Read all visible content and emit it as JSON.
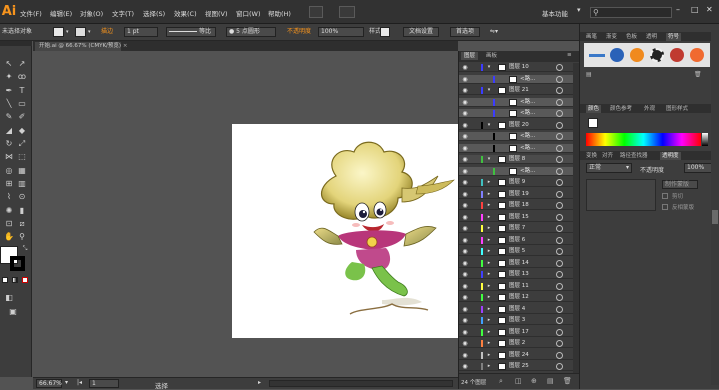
{
  "app": {
    "logo": "Ai"
  },
  "menu": [
    "文件(F)",
    "编辑(E)",
    "对象(O)",
    "文字(T)",
    "选择(S)",
    "效果(C)",
    "视图(V)",
    "窗口(W)",
    "帮助(H)"
  ],
  "workspace": "基本功能",
  "search_icon": "search-icon",
  "window_buttons": [
    "–",
    "□",
    "✕"
  ],
  "controlbar": {
    "selection": "未选择对象",
    "stroke_label": "描边",
    "stroke_value": "1 pt",
    "profile_label": "等比",
    "brush_value": "5 点圆形",
    "opacity_label": "不透明度",
    "opacity_value": "100%",
    "style_label": "样式",
    "doc_setup": "文档设置",
    "preferences": "首选项"
  },
  "document_tab": "开始.ai @ 66.67% (CMYK/预览)",
  "layers_panel": {
    "tabs": [
      "图层",
      "画板"
    ],
    "rows": [
      {
        "name": "图层 10",
        "color": "#3c3cff",
        "expanded": true,
        "sub": false
      },
      {
        "name": "<路...",
        "color": "#3c3cff",
        "expanded": false,
        "sub": true
      },
      {
        "name": "图层 21",
        "color": "#3c3cff",
        "expanded": true,
        "sub": false
      },
      {
        "name": "<路...",
        "color": "#3c3cff",
        "expanded": false,
        "sub": true
      },
      {
        "name": "<路...",
        "color": "#3c3cff",
        "expanded": false,
        "sub": true
      },
      {
        "name": "图层 20",
        "color": "#000000",
        "expanded": true,
        "sub": false
      },
      {
        "name": "<路...",
        "color": "#000000",
        "expanded": false,
        "sub": true
      },
      {
        "name": "<路...",
        "color": "#000000",
        "expanded": false,
        "sub": true
      },
      {
        "name": "图层 8",
        "color": "#40c040",
        "expanded": true,
        "sub": false
      },
      {
        "name": "<路...",
        "color": "#40c040",
        "expanded": false,
        "sub": true
      },
      {
        "name": "图层 9",
        "color": "#40c0c0",
        "expanded": false,
        "sub": false
      },
      {
        "name": "图层 19",
        "color": "#8080ff",
        "expanded": false,
        "sub": false
      },
      {
        "name": "图层 18",
        "color": "#ff4040",
        "expanded": false,
        "sub": false
      },
      {
        "name": "图层 15",
        "color": "#ff40ff",
        "expanded": false,
        "sub": false
      },
      {
        "name": "图层 7",
        "color": "#ffff40",
        "expanded": false,
        "sub": false
      },
      {
        "name": "图层 6",
        "color": "#ff40ff",
        "expanded": false,
        "sub": false
      },
      {
        "name": "图层 5",
        "color": "#40ffff",
        "expanded": false,
        "sub": false
      },
      {
        "name": "图层 14",
        "color": "#40ff40",
        "expanded": false,
        "sub": false
      },
      {
        "name": "图层 13",
        "color": "#4040ff",
        "expanded": false,
        "sub": false
      },
      {
        "name": "图层 11",
        "color": "#ffff40",
        "expanded": false,
        "sub": false
      },
      {
        "name": "图层 12",
        "color": "#40ff40",
        "expanded": false,
        "sub": false
      },
      {
        "name": "图层 4",
        "color": "#a040ff",
        "expanded": false,
        "sub": false
      },
      {
        "name": "图层 3",
        "color": "#40a0ff",
        "expanded": false,
        "sub": false
      },
      {
        "name": "图层 17",
        "color": "#40ff40",
        "expanded": false,
        "sub": false
      },
      {
        "name": "图层 2",
        "color": "#ff8040",
        "expanded": false,
        "sub": false
      },
      {
        "name": "图层 24",
        "color": "#c0c0c0",
        "expanded": false,
        "sub": false
      },
      {
        "name": "图层 25",
        "color": "#808080",
        "expanded": false,
        "sub": false
      }
    ],
    "footer": "24 个图层"
  },
  "brush_panel": {
    "tabs": [
      "画笔",
      "渐变",
      "色板",
      "透明",
      "符号"
    ]
  },
  "color_panel": {
    "tabs": [
      "颜色",
      "颜色参考",
      "外观",
      "图形样式"
    ]
  },
  "transparency_panel": {
    "tabs": [
      "变换",
      "对齐",
      "路径查找器",
      "透明度"
    ],
    "mode": "正常",
    "opacity_label": "不透明度",
    "opacity_value": "100%",
    "buttons": [
      "制作蒙版",
      "剪切",
      "反相蒙版"
    ]
  },
  "status": {
    "zoom": "66.67%",
    "page": "1",
    "tool": "选择"
  },
  "colors": {
    "accent": "#f7941d"
  }
}
